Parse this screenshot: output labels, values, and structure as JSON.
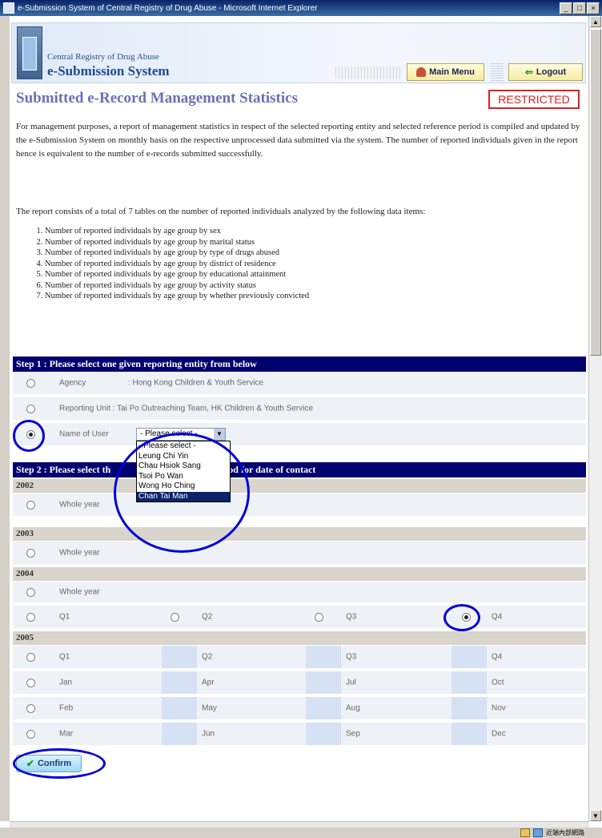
{
  "window": {
    "title": "e-Submission System of Central Registry of Drug Abuse - Microsoft Internet Explorer",
    "controls": [
      "_",
      "□",
      "×"
    ]
  },
  "header": {
    "org": "Central Registry of Drug Abuse",
    "app": "e-Submission System",
    "main_menu": "Main Menu",
    "logout": "Logout"
  },
  "page": {
    "title": "Submitted e-Record Management Statistics",
    "badge": "RESTRICTED",
    "intro": "For management purposes, a report of management statistics in respect of the selected reporting entity and selected reference period is compiled and updated by the e-Submission System on monthly basis on the respective unprocessed data submitted via the system. The number of reported individuals given in the report hence is equivalent to the number of e-records submitted successfully.",
    "tables_intro": "The report consists of a total of 7 tables on the number of reported individuals analyzed by the following data items:",
    "items": [
      "Number of reported individuals by age group by sex",
      "Number of reported individuals by age group by marital status",
      "Number of reported individuals by age group by type of drugs abused",
      "Number of reported individuals by age group by district of residence",
      "Number of reported individuals by age group by educational attainment",
      "Number of reported individuals by age group by activity status",
      "Number of reported individuals by age group by whether previously convicted"
    ]
  },
  "step1": {
    "title": "Step 1 : Please select one given reporting entity from below",
    "agency_label": "Agency",
    "agency_value": ": Hong Kong Children & Youth Service",
    "unit_text": "Reporting Unit : Tai Po Outreaching Team, HK Children & Youth Service",
    "user_label": "Name of User",
    "select_value": "- Please select -",
    "select_arrow": "▼",
    "options": [
      "- Please select -",
      "Leung Chi Yin",
      "Chau Hsiok Sang",
      "Tsoi Po Wan",
      "Wong Ho Ching",
      "Chan Tai Man"
    ]
  },
  "step2": {
    "title_left": "Step 2 : Please select th",
    "title_right": "e period for date of contact",
    "whole_year": "Whole year",
    "years": [
      "2002",
      "2003",
      "2004",
      "2005"
    ],
    "quarters": [
      "Q1",
      "Q2",
      "Q3",
      "Q4"
    ],
    "months": [
      [
        "Jan",
        "Apr",
        "Jul",
        "Oct"
      ],
      [
        "Feb",
        "May",
        "Aug",
        "Nov"
      ],
      [
        "Mar",
        "Jun",
        "Sep",
        "Dec"
      ]
    ]
  },
  "confirm": "Confirm",
  "statusbar": {
    "zone": "近端內部網路"
  },
  "colors": {
    "step_bar": "#00006e",
    "restricted": "#e02020",
    "annotation": "#0000d8"
  }
}
